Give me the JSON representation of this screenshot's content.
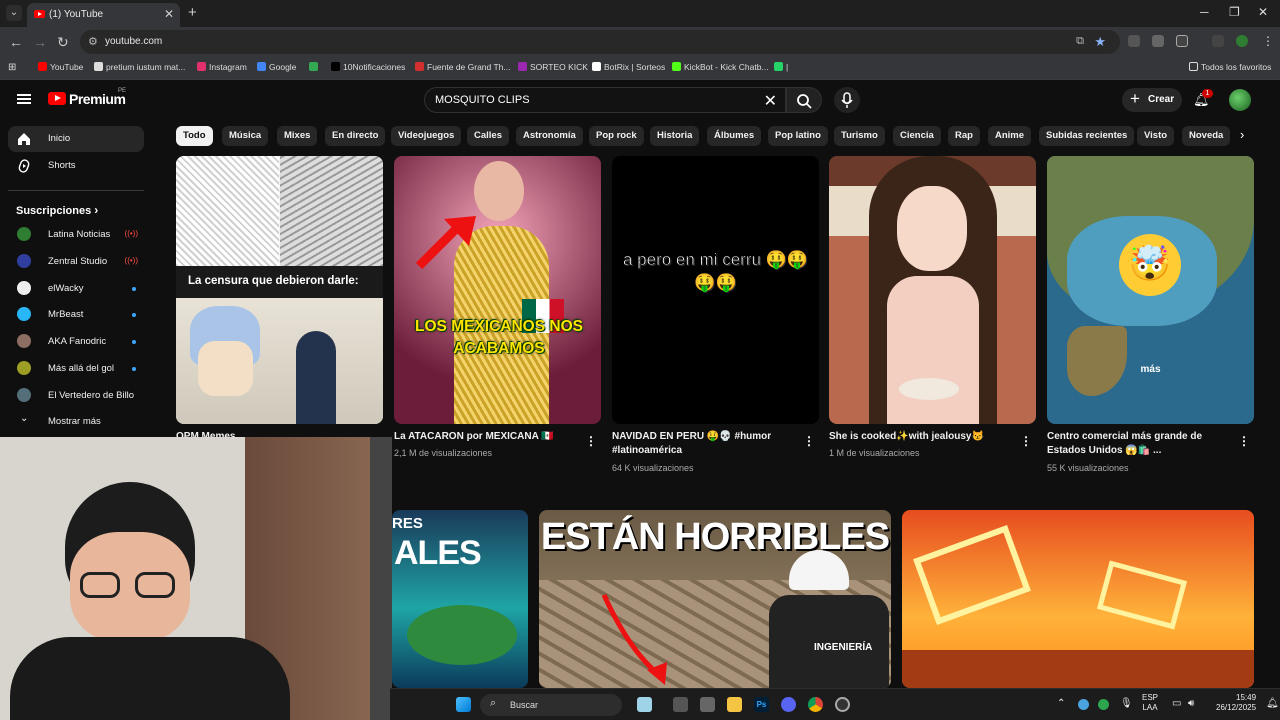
{
  "browser": {
    "tab_title": "(1) YouTube",
    "url": "youtube.com",
    "bookmarks": [
      {
        "label": "YouTube",
        "color": "#ff0000"
      },
      {
        "label": "pretium iustum mat...",
        "color": "#dddddd"
      },
      {
        "label": "Instagram",
        "color": "#e1306c"
      },
      {
        "label": "Google",
        "color": "#4285f4"
      },
      {
        "label": "",
        "color": "#34a853"
      },
      {
        "label": "10Notificaciones",
        "color": "#000000"
      },
      {
        "label": "Fuente de Grand Th...",
        "color": "#d32f2f"
      },
      {
        "label": "SORTEO KICK",
        "color": "#9c27b0"
      },
      {
        "label": "BotRix | Sorteos",
        "color": "#ffffff"
      },
      {
        "label": "KickBot - Kick Chatb...",
        "color": "#53fc18"
      },
      {
        "label": "|",
        "color": "#25d366"
      }
    ],
    "all_bookmarks": "Todos los favoritos"
  },
  "youtube": {
    "logo_text": "Premium",
    "country_code": "PE",
    "search_query": "MOSQUITO CLIPS",
    "create_label": "Crear",
    "notifications_count": "1"
  },
  "sidebar": {
    "main": [
      {
        "label": "Inicio",
        "active": true
      },
      {
        "label": "Shorts",
        "active": false
      }
    ],
    "subscriptions_title": "Suscripciones",
    "subscriptions": [
      {
        "label": "Latina Noticias",
        "color": "#2e7d32",
        "status": "live"
      },
      {
        "label": "Zentral Studio",
        "color": "#303f9f",
        "status": "live"
      },
      {
        "label": "elWacky",
        "color": "#eeeeee",
        "status": "new"
      },
      {
        "label": "MrBeast",
        "color": "#29b6f6",
        "status": "new"
      },
      {
        "label": "AKA Fanodric",
        "color": "#8d6e63",
        "status": "new"
      },
      {
        "label": "Más allá del gol",
        "color": "#9e9d24",
        "status": "new"
      },
      {
        "label": "El Vertedero de Billo",
        "color": "#546e7a",
        "status": "none"
      }
    ],
    "show_more": "Mostrar más"
  },
  "chips": [
    "Todo",
    "Música",
    "Mixes",
    "En directo",
    "Videojuegos",
    "Calles",
    "Astronomía",
    "Pop rock",
    "Historia",
    "Álbumes",
    "Pop latino",
    "Turismo",
    "Ciencia",
    "Rap",
    "Anime",
    "Subidas recientes",
    "Visto",
    "Noveda"
  ],
  "shorts": [
    {
      "title": "OPM Memes",
      "meta": "",
      "overlay": "La censura que debieron darle:"
    },
    {
      "title": "La ATACARON por MEXICANA 🇲🇽",
      "meta": "2,1 M de visualizaciones",
      "overlay": "LOS MEXICANOS NOS ACABAMOS"
    },
    {
      "title": "NAVIDAD EN PERU 🤑💀 #humor #latinoamérica",
      "meta": "64 K visualizaciones",
      "overlay": "a pero en mi cerru 🤑🤑🤑🤑"
    },
    {
      "title": "She is cooked✨with jealousy😾",
      "meta": "1 M de visualizaciones",
      "overlay": ""
    },
    {
      "title": "Centro comercial más grande de Estados Unidos 😱🛍️ ...",
      "meta": "55 K visualizaciones",
      "overlay": "más"
    }
  ],
  "videos": [
    {
      "overlay": "ALES",
      "overlay_small": "RES"
    },
    {
      "overlay": "ESTÁN HORRIBLES",
      "badge": "INGENIERÍA"
    },
    {
      "overlay": ""
    }
  ],
  "taskbar": {
    "search_label": "Buscar",
    "lang_top": "ESP",
    "lang_bottom": "LAA",
    "time": "15:49",
    "date": "26/12/2025"
  }
}
